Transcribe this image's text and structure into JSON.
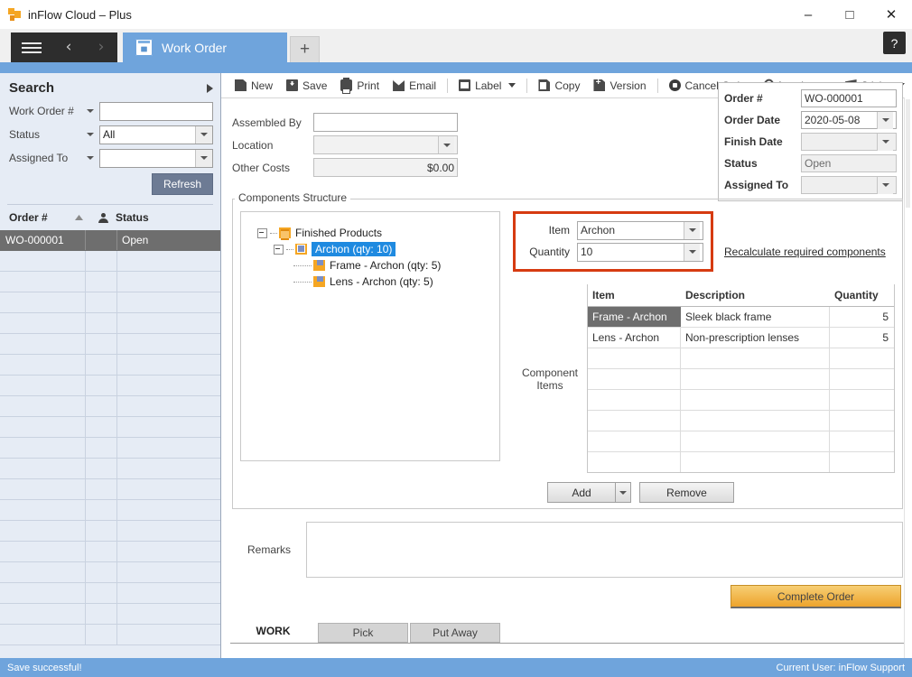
{
  "window": {
    "title": "inFlow Cloud – Plus",
    "minimize": "–",
    "maximize": "□",
    "close": "✕",
    "help": "?"
  },
  "tabstrip": {
    "menu_icon": "hamburger-icon",
    "back": "‹",
    "forward": "›",
    "tab_label": "Work Order",
    "new_tab": "+"
  },
  "toolbar": {
    "items": [
      {
        "label": "New",
        "icon": "new-document-icon"
      },
      {
        "label": "Save",
        "icon": "save-icon"
      },
      {
        "label": "Print",
        "icon": "printer-icon"
      },
      {
        "label": "Email",
        "icon": "envelope-icon"
      },
      {
        "label": "Label",
        "icon": "label-icon"
      },
      {
        "label": "Copy",
        "icon": "copy-icon"
      },
      {
        "label": "Version",
        "icon": "version-icon"
      },
      {
        "label": "Cancel Order",
        "icon": "cancel-icon"
      },
      {
        "label": "Attachment",
        "icon": "paperclip-icon"
      },
      {
        "label": "Sticky",
        "icon": "sticky-note-icon"
      }
    ]
  },
  "search": {
    "title": "Search",
    "fields": [
      {
        "label": "Work Order #",
        "value": "",
        "type": "text"
      },
      {
        "label": "Status",
        "value": "All",
        "type": "combo"
      },
      {
        "label": "Assigned To",
        "value": "",
        "type": "combo"
      }
    ],
    "refresh_label": "Refresh",
    "grid": {
      "columns": [
        "Order #",
        "Status"
      ],
      "rows": [
        {
          "order": "WO-000001",
          "status": "Open",
          "selected": true
        },
        {
          "order": "",
          "status": "",
          "selected": false
        },
        {
          "order": "",
          "status": "",
          "selected": false
        },
        {
          "order": "",
          "status": "",
          "selected": false
        },
        {
          "order": "",
          "status": "",
          "selected": false
        },
        {
          "order": "",
          "status": "",
          "selected": false
        },
        {
          "order": "",
          "status": "",
          "selected": false
        },
        {
          "order": "",
          "status": "",
          "selected": false
        },
        {
          "order": "",
          "status": "",
          "selected": false
        },
        {
          "order": "",
          "status": "",
          "selected": false
        },
        {
          "order": "",
          "status": "",
          "selected": false
        },
        {
          "order": "",
          "status": "",
          "selected": false
        },
        {
          "order": "",
          "status": "",
          "selected": false
        },
        {
          "order": "",
          "status": "",
          "selected": false
        },
        {
          "order": "",
          "status": "",
          "selected": false
        },
        {
          "order": "",
          "status": "",
          "selected": false
        },
        {
          "order": "",
          "status": "",
          "selected": false
        },
        {
          "order": "",
          "status": "",
          "selected": false
        },
        {
          "order": "",
          "status": "",
          "selected": false
        },
        {
          "order": "",
          "status": "",
          "selected": false
        }
      ]
    }
  },
  "form": {
    "assembled_by": {
      "label": "Assembled By",
      "value": ""
    },
    "location": {
      "label": "Location",
      "value": ""
    },
    "other_costs": {
      "label": "Other Costs",
      "value": "$0.00"
    }
  },
  "order_info": {
    "order_no": {
      "label": "Order #",
      "value": "WO-000001"
    },
    "order_date": {
      "label": "Order Date",
      "value": "2020-05-08"
    },
    "finish_date": {
      "label": "Finish Date",
      "value": ""
    },
    "status": {
      "label": "Status",
      "value": "Open"
    },
    "assigned_to": {
      "label": "Assigned To",
      "value": ""
    }
  },
  "components": {
    "section_title": "Components Structure",
    "tree": [
      {
        "label": "Finished Products",
        "level": 1,
        "icon": "folder-icon",
        "selected": false
      },
      {
        "label": "Archon  (qty: 10)",
        "level": 2,
        "icon": "product-icon",
        "selected": true
      },
      {
        "label": "Frame - Archon  (qty: 5)",
        "level": 3,
        "icon": "part-icon",
        "selected": false
      },
      {
        "label": "Lens - Archon  (qty: 5)",
        "level": 3,
        "icon": "part-icon",
        "selected": false
      }
    ],
    "item_field": {
      "label": "Item",
      "value": "Archon"
    },
    "quantity_field": {
      "label": "Quantity",
      "value": "10"
    },
    "recalculate_link": "Recalculate required components",
    "component_items_label": "Component Items",
    "table": {
      "columns": [
        "Item",
        "Description",
        "Quantity"
      ],
      "rows": [
        {
          "item": "Frame - Archon",
          "description": "Sleek black frame",
          "quantity": "5",
          "selected": true
        },
        {
          "item": "Lens - Archon",
          "description": "Non-prescription lenses",
          "quantity": "5",
          "selected": false
        },
        {
          "item": "",
          "description": "",
          "quantity": "",
          "selected": false
        },
        {
          "item": "",
          "description": "",
          "quantity": "",
          "selected": false
        },
        {
          "item": "",
          "description": "",
          "quantity": "",
          "selected": false
        },
        {
          "item": "",
          "description": "",
          "quantity": "",
          "selected": false
        },
        {
          "item": "",
          "description": "",
          "quantity": "",
          "selected": false
        },
        {
          "item": "",
          "description": "",
          "quantity": "",
          "selected": false
        }
      ]
    },
    "add_label": "Add",
    "remove_label": "Remove"
  },
  "remarks": {
    "label": "Remarks",
    "value": ""
  },
  "complete_button": "Complete Order",
  "bottom_tabs": [
    {
      "label": "WORK",
      "active": true
    },
    {
      "label": "Pick",
      "active": false
    },
    {
      "label": "Put Away",
      "active": false
    }
  ],
  "statusbar": {
    "message": "Save successful!",
    "user_label": "Current User:",
    "user_name": "inFlow Support"
  },
  "colors": {
    "accent_blue": "#6fa4dc",
    "highlight_red": "#d63b11",
    "selection_blue": "#1f8ae0",
    "complete_orange": "#eda32c",
    "tree_orange": "#f5a623"
  }
}
